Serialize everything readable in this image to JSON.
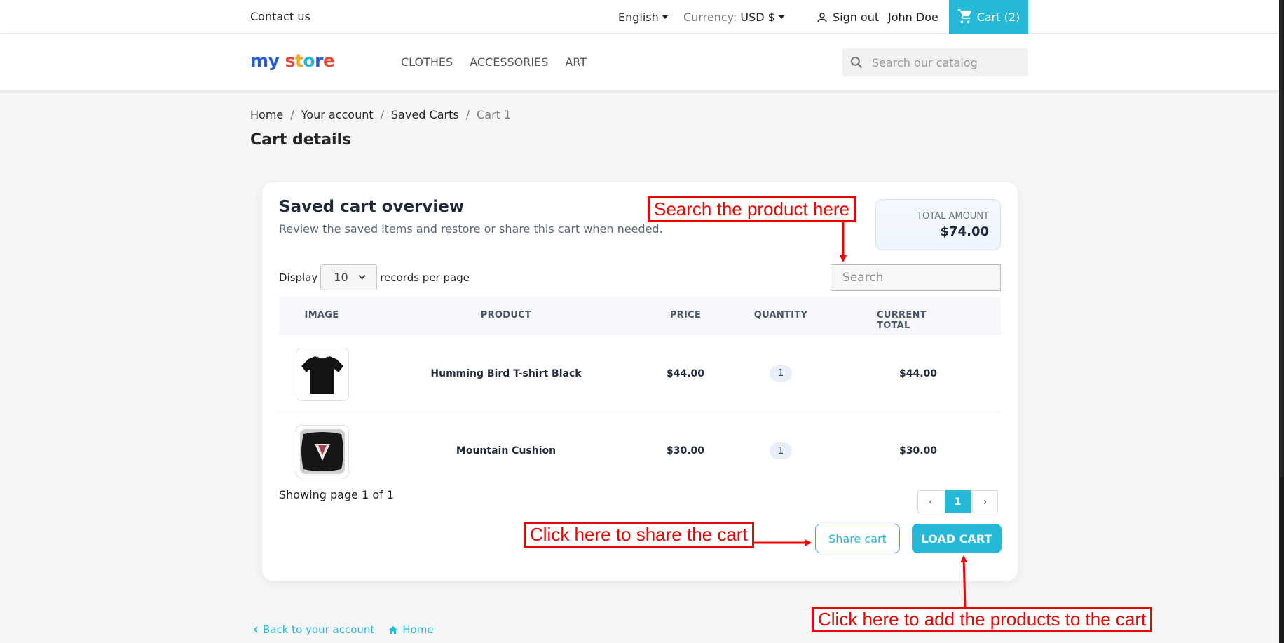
{
  "topbar": {
    "contact": "Contact us",
    "language": "English",
    "currency_label": "Currency:",
    "currency_value": "USD $",
    "sign_out": "Sign out",
    "user": "John Doe",
    "cart": "Cart (2)"
  },
  "header": {
    "logo": [
      "m",
      "y",
      " ",
      "s",
      "t",
      "o",
      "r",
      "e"
    ],
    "logo_colors": [
      "#2a5bd7",
      "#2a5bd7",
      "",
      "#e8473b",
      "#f5a623",
      "#24b9d7",
      "#2a5bd7",
      "#e8473b"
    ],
    "nav": [
      "CLOTHES",
      "ACCESSORIES",
      "ART"
    ],
    "search_placeholder": "Search our catalog"
  },
  "breadcrumb": {
    "items": [
      "Home",
      "Your account",
      "Saved Carts"
    ],
    "current": "Cart 1"
  },
  "page_title": "Cart details",
  "card": {
    "title": "Saved cart overview",
    "subtitle": "Review the saved items and restore or share this cart when needed.",
    "total_label": "TOTAL AMOUNT",
    "total_amount": "$74.00",
    "display_label": "Display",
    "per_page": "10",
    "records_label": "records per page",
    "search_placeholder": "Search",
    "columns": [
      "IMAGE",
      "PRODUCT",
      "PRICE",
      "QUANTITY",
      "CURRENT TOTAL"
    ],
    "rows": [
      {
        "product": "Humming Bird T-shirt Black",
        "price": "$44.00",
        "quantity": "1",
        "total": "$44.00",
        "image_icon": "tshirt-black-icon"
      },
      {
        "product": "Mountain Cushion",
        "price": "$30.00",
        "quantity": "1",
        "total": "$30.00",
        "image_icon": "cushion-icon"
      }
    ],
    "showing": "Showing page 1 of 1",
    "pager": {
      "prev": "‹",
      "page": "1",
      "next": "›"
    },
    "share_button": "Share cart",
    "load_button": "LOAD CART"
  },
  "footer": {
    "back": "Back to your account",
    "home": "Home"
  },
  "annotations": {
    "search": "Search the product here",
    "share": "Click here to share the cart",
    "load": "Click here to add the products to the cart"
  },
  "colors": {
    "accent": "#24b9d7",
    "annotation": "#ee0000"
  }
}
